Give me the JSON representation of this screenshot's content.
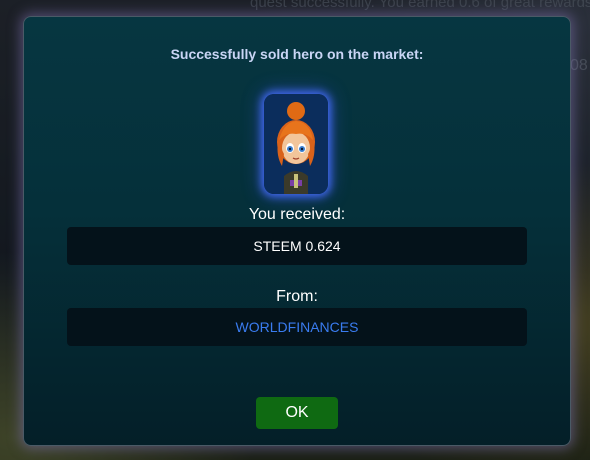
{
  "background": {
    "top_text": "quest successfully. You earned 0.6 of great rewards",
    "right_text": "08"
  },
  "dialog": {
    "title": "Successfully sold hero on the market:",
    "hero_icon": "red-haired-hero-portrait",
    "received_label": "You received:",
    "received_value": "STEEM 0.624",
    "from_label": "From:",
    "from_value": "WORLDFINANCES",
    "ok_label": "OK"
  },
  "colors": {
    "dialog_bg": "#063641",
    "title": "#c9d5f5",
    "value_box": "#04121a",
    "username_link": "#3a7cf0",
    "ok_button": "#0f6a12",
    "hero_glow": "#466eff"
  }
}
